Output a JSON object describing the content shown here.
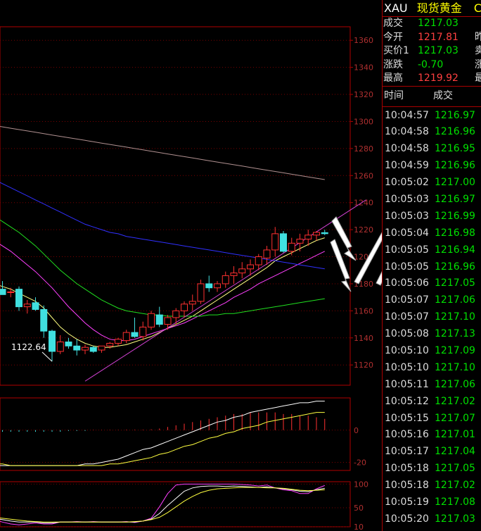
{
  "header": {
    "code": "XAU",
    "name": "现货黄金",
    "extra": "C"
  },
  "quote": [
    {
      "label": "成交",
      "value": "1217.03",
      "color": "#00e000",
      "cut": ""
    },
    {
      "label": "今开",
      "value": "1217.81",
      "color": "#ff4040",
      "cut": "昨"
    },
    {
      "label": "买价1",
      "value": "1217.03",
      "color": "#00e000",
      "cut": "卖"
    },
    {
      "label": "涨跌",
      "value": "-0.70",
      "color": "#00e000",
      "cut": "涨"
    },
    {
      "label": "最高",
      "value": "1219.92",
      "color": "#ff4040",
      "cut": "最"
    }
  ],
  "ticks_header": {
    "time": "时间",
    "price": "成交"
  },
  "ticks": [
    {
      "time": "10:04:57",
      "price": "1216.97"
    },
    {
      "time": "10:04:58",
      "price": "1216.96"
    },
    {
      "time": "10:04:58",
      "price": "1216.95"
    },
    {
      "time": "10:04:59",
      "price": "1216.96"
    },
    {
      "time": "10:05:02",
      "price": "1217.00"
    },
    {
      "time": "10:05:03",
      "price": "1216.97"
    },
    {
      "time": "10:05:03",
      "price": "1216.99"
    },
    {
      "time": "10:05:04",
      "price": "1216.98"
    },
    {
      "time": "10:05:05",
      "price": "1216.94"
    },
    {
      "time": "10:05:05",
      "price": "1216.96"
    },
    {
      "time": "10:05:06",
      "price": "1217.05"
    },
    {
      "time": "10:05:07",
      "price": "1217.06"
    },
    {
      "time": "10:05:07",
      "price": "1217.10"
    },
    {
      "time": "10:05:08",
      "price": "1217.13"
    },
    {
      "time": "10:05:10",
      "price": "1217.09"
    },
    {
      "time": "10:05:10",
      "price": "1217.10"
    },
    {
      "time": "10:05:11",
      "price": "1217.06"
    },
    {
      "time": "10:05:12",
      "price": "1217.02"
    },
    {
      "time": "10:05:15",
      "price": "1217.07"
    },
    {
      "time": "10:05:16",
      "price": "1217.01"
    },
    {
      "time": "10:05:17",
      "price": "1217.04"
    },
    {
      "time": "10:05:18",
      "price": "1217.05"
    },
    {
      "time": "10:05:18",
      "price": "1217.02"
    },
    {
      "time": "10:05:19",
      "price": "1217.08"
    },
    {
      "time": "10:05:20",
      "price": "1217.03"
    }
  ],
  "chart_data": [
    {
      "type": "candlestick",
      "ylim": [
        1105,
        1370
      ],
      "yticks": [
        1120,
        1140,
        1160,
        1180,
        1200,
        1220,
        1240,
        1260,
        1280,
        1300,
        1320,
        1340,
        1360
      ],
      "ytick_labels": [
        "1120",
        "1140",
        "1160",
        "1180",
        "1200",
        "1220",
        "1240",
        "1260",
        "1280",
        "1300",
        "1320",
        "1340",
        "1360"
      ],
      "annotation": "1122.64",
      "candles": [
        {
          "o": 1180,
          "h": 1183,
          "l": 1173,
          "c": 1177
        },
        {
          "o": 1178,
          "h": 1183,
          "l": 1174,
          "c": 1181
        },
        {
          "o": 1176,
          "h": 1182,
          "l": 1172,
          "c": 1172
        },
        {
          "o": 1174,
          "h": 1177,
          "l": 1170,
          "c": 1174
        },
        {
          "o": 1176,
          "h": 1178,
          "l": 1160,
          "c": 1163
        },
        {
          "o": 1163,
          "h": 1168,
          "l": 1158,
          "c": 1165
        },
        {
          "o": 1166,
          "h": 1170,
          "l": 1160,
          "c": 1161
        },
        {
          "o": 1161,
          "h": 1164,
          "l": 1140,
          "c": 1145
        },
        {
          "o": 1145,
          "h": 1146,
          "l": 1122.64,
          "c": 1130
        },
        {
          "o": 1130,
          "h": 1142,
          "l": 1128,
          "c": 1137
        },
        {
          "o": 1137,
          "h": 1140,
          "l": 1132,
          "c": 1134
        },
        {
          "o": 1134,
          "h": 1139,
          "l": 1127,
          "c": 1131
        },
        {
          "o": 1131,
          "h": 1135,
          "l": 1128,
          "c": 1133
        },
        {
          "o": 1133,
          "h": 1134,
          "l": 1129,
          "c": 1130
        },
        {
          "o": 1131,
          "h": 1134,
          "l": 1129,
          "c": 1134
        },
        {
          "o": 1134,
          "h": 1137,
          "l": 1132,
          "c": 1136
        },
        {
          "o": 1136,
          "h": 1140,
          "l": 1134,
          "c": 1139
        },
        {
          "o": 1138,
          "h": 1146,
          "l": 1136,
          "c": 1144
        },
        {
          "o": 1144,
          "h": 1155,
          "l": 1140,
          "c": 1141
        },
        {
          "o": 1141,
          "h": 1152,
          "l": 1138,
          "c": 1148
        },
        {
          "o": 1148,
          "h": 1160,
          "l": 1146,
          "c": 1158
        },
        {
          "o": 1157,
          "h": 1163,
          "l": 1148,
          "c": 1150
        },
        {
          "o": 1150,
          "h": 1157,
          "l": 1146,
          "c": 1155
        },
        {
          "o": 1155,
          "h": 1162,
          "l": 1150,
          "c": 1160
        },
        {
          "o": 1160,
          "h": 1167,
          "l": 1155,
          "c": 1165
        },
        {
          "o": 1165,
          "h": 1172,
          "l": 1160,
          "c": 1167
        },
        {
          "o": 1167,
          "h": 1183,
          "l": 1165,
          "c": 1180
        },
        {
          "o": 1180,
          "h": 1186,
          "l": 1174,
          "c": 1177
        },
        {
          "o": 1177,
          "h": 1182,
          "l": 1174,
          "c": 1180
        },
        {
          "o": 1180,
          "h": 1189,
          "l": 1177,
          "c": 1186
        },
        {
          "o": 1186,
          "h": 1193,
          "l": 1180,
          "c": 1188
        },
        {
          "o": 1188,
          "h": 1196,
          "l": 1184,
          "c": 1191
        },
        {
          "o": 1191,
          "h": 1198,
          "l": 1186,
          "c": 1194
        },
        {
          "o": 1194,
          "h": 1202,
          "l": 1190,
          "c": 1200
        },
        {
          "o": 1199,
          "h": 1208,
          "l": 1194,
          "c": 1205
        },
        {
          "o": 1205,
          "h": 1222,
          "l": 1200,
          "c": 1217
        },
        {
          "o": 1217,
          "h": 1219,
          "l": 1203,
          "c": 1204
        },
        {
          "o": 1204,
          "h": 1214,
          "l": 1201,
          "c": 1210
        },
        {
          "o": 1210,
          "h": 1217,
          "l": 1204,
          "c": 1213
        },
        {
          "o": 1213,
          "h": 1220,
          "l": 1208,
          "c": 1216
        },
        {
          "o": 1216,
          "h": 1219,
          "l": 1212,
          "c": 1218
        },
        {
          "o": 1217.81,
          "h": 1219.92,
          "l": 1216,
          "c": 1217.03
        }
      ],
      "moving_averages": [
        {
          "color": "#ffff80",
          "values": [
            1181,
            1180,
            1178,
            1176,
            1173,
            1170,
            1167,
            1162,
            1155,
            1148,
            1143,
            1139,
            1136,
            1134,
            1133,
            1133,
            1134,
            1135,
            1137,
            1139,
            1141,
            1144,
            1147,
            1150,
            1153,
            1156,
            1160,
            1164,
            1168,
            1172,
            1176,
            1180,
            1184,
            1188,
            1192,
            1197,
            1200,
            1203,
            1206,
            1209,
            1212,
            1214
          ]
        },
        {
          "color": "#ff40ff",
          "values": [
            1215,
            1212,
            1208,
            1204,
            1199,
            1194,
            1189,
            1183,
            1177,
            1170,
            1163,
            1157,
            1151,
            1146,
            1142,
            1139,
            1138,
            1138,
            1139,
            1141,
            1143,
            1145,
            1147,
            1149,
            1151,
            1154,
            1157,
            1160,
            1163,
            1166,
            1170,
            1173,
            1176,
            1180,
            1183,
            1186,
            1189,
            1192,
            1195,
            1198,
            1201,
            1204
          ]
        },
        {
          "color": "#20e020",
          "values": [
            1233,
            1230,
            1226,
            1222,
            1218,
            1213,
            1208,
            1202,
            1196,
            1190,
            1185,
            1180,
            1176,
            1172,
            1168,
            1165,
            1162,
            1160,
            1159,
            1158,
            1157,
            1157,
            1156,
            1156,
            1156,
            1156,
            1156,
            1157,
            1157,
            1158,
            1158,
            1159,
            1160,
            1161,
            1162,
            1163,
            1164,
            1165,
            1166,
            1167,
            1168,
            1169
          ]
        },
        {
          "color": "#3030ff",
          "values": [
            1259,
            1257,
            1254,
            1251,
            1248,
            1245,
            1242,
            1239,
            1236,
            1233,
            1230,
            1227,
            1224,
            1222,
            1220,
            1218,
            1217,
            1215,
            1214,
            1213,
            1212,
            1211,
            1210,
            1209,
            1208,
            1207,
            1206,
            1205,
            1204,
            1203,
            1202,
            1201,
            1200,
            1199,
            1198,
            1197,
            1196,
            1195,
            1194,
            1193,
            1192,
            1191
          ]
        },
        {
          "color": "#b09090",
          "values": [
            1298,
            1297,
            1296,
            1295,
            1294,
            1293,
            1292,
            1291,
            1290,
            1289,
            1288,
            1287,
            1286,
            1285,
            1284,
            1283,
            1282,
            1281,
            1280,
            1279,
            1278,
            1277,
            1276,
            1275,
            1274,
            1273,
            1272,
            1271,
            1270,
            1269,
            1268,
            1267,
            1266,
            1265,
            1264,
            1263,
            1262,
            1261,
            1260,
            1259,
            1258,
            1257
          ]
        }
      ],
      "trend_line": {
        "color": "#d040d0",
        "from": [
          12,
          1108
        ],
        "to": [
          46,
          1242
        ]
      }
    },
    {
      "type": "macd",
      "ylim": [
        -25,
        20
      ],
      "yticks": [
        0,
        -20
      ],
      "ytick_labels": [
        "0",
        "-20"
      ],
      "hist": [
        -1,
        -1,
        -1,
        -1,
        -1,
        -1,
        -1,
        -1,
        -1,
        -1,
        -0.5,
        -0.5,
        -0.5,
        0.2,
        0.2,
        0.2,
        0.2,
        0.3,
        0.3,
        0.3,
        0.5,
        1,
        2,
        3,
        4,
        5,
        6,
        7,
        8,
        9,
        10,
        10,
        11,
        11,
        11,
        11,
        10,
        10,
        9,
        9,
        8,
        7
      ],
      "dif": [
        -22,
        -22,
        -22,
        -22,
        -22,
        -22,
        -22,
        -22,
        -22,
        -22,
        -22,
        -22,
        -21,
        -21,
        -20,
        -19,
        -18,
        -16,
        -14,
        -12,
        -11,
        -9,
        -7,
        -5,
        -3,
        -1,
        1,
        3,
        5,
        6,
        8,
        9,
        11,
        12,
        13,
        14,
        15,
        16,
        17,
        17,
        18,
        18
      ],
      "dea": [
        -21,
        -21,
        -21,
        -22,
        -22,
        -22,
        -22,
        -22,
        -22,
        -22,
        -22,
        -22,
        -22,
        -22,
        -22,
        -21,
        -21,
        -20,
        -19,
        -18,
        -17,
        -15,
        -14,
        -12,
        -10,
        -9,
        -7,
        -5,
        -4,
        -2,
        -1,
        1,
        2,
        3,
        5,
        6,
        7,
        8,
        9,
        10,
        11,
        11
      ]
    },
    {
      "type": "kdj",
      "ylim": [
        10,
        105
      ],
      "yticks": [
        100,
        50,
        10
      ],
      "ytick_labels": [
        "100",
        "50",
        "10"
      ],
      "k": [
        30,
        28,
        25,
        22,
        20,
        20,
        20,
        18,
        18,
        20,
        20,
        20,
        20,
        20,
        20,
        20,
        20,
        20,
        20,
        22,
        26,
        38,
        55,
        70,
        85,
        92,
        95,
        96,
        96,
        95,
        96,
        95,
        94,
        93,
        94,
        92,
        90,
        88,
        85,
        84,
        88,
        91
      ],
      "d": [
        31,
        30,
        28,
        26,
        24,
        22,
        21,
        20,
        20,
        20,
        20,
        20,
        20,
        20,
        20,
        20,
        20,
        20,
        21,
        22,
        25,
        30,
        40,
        52,
        64,
        74,
        82,
        87,
        90,
        91,
        92,
        93,
        93,
        93,
        92,
        92,
        91,
        89,
        87,
        86,
        87,
        88
      ],
      "j": [
        28,
        25,
        20,
        16,
        14,
        16,
        18,
        16,
        16,
        20,
        20,
        21,
        20,
        21,
        20,
        20,
        20,
        21,
        19,
        22,
        28,
        52,
        80,
        98,
        100,
        100,
        100,
        100,
        100,
        100,
        100,
        99,
        98,
        96,
        98,
        92,
        88,
        86,
        80,
        80,
        90,
        97
      ]
    }
  ]
}
